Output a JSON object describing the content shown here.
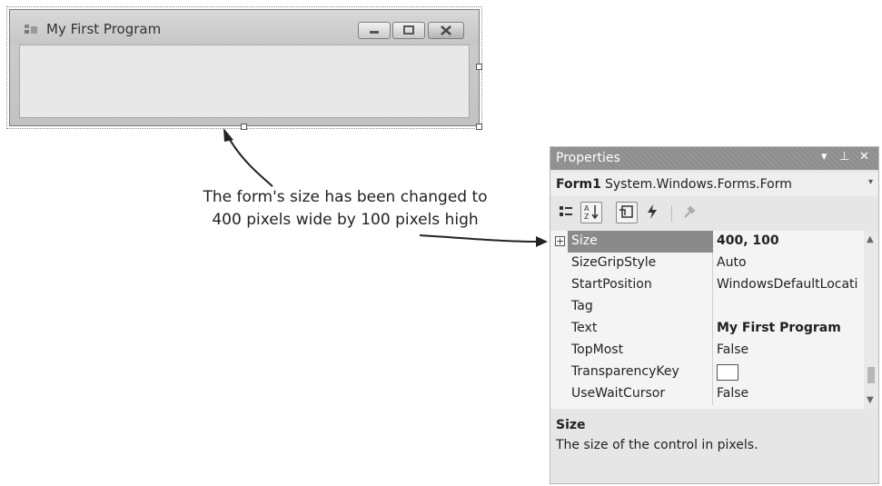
{
  "form": {
    "title": "My First Program",
    "controls": [
      "minimize",
      "maximize",
      "close"
    ]
  },
  "annotation": {
    "line1": "The form's size has been changed to",
    "line2": "400 pixels wide by 100 pixels high"
  },
  "properties": {
    "panel_title": "Properties",
    "title_icons": [
      "dropdown-icon",
      "pin-icon",
      "close-icon"
    ],
    "object_name": "Form1",
    "object_type": "System.Windows.Forms.Form",
    "toolbar_icons": [
      "categorized-icon",
      "alphabetical-icon",
      "properties-icon",
      "events-icon",
      "property-pages-icon"
    ],
    "rows": [
      {
        "name": "Size",
        "value": "400, 100",
        "selected": true,
        "bold": true,
        "expandable": true
      },
      {
        "name": "SizeGripStyle",
        "value": "Auto"
      },
      {
        "name": "StartPosition",
        "value": "WindowsDefaultLocati"
      },
      {
        "name": "Tag",
        "value": ""
      },
      {
        "name": "Text",
        "value": "My First Program",
        "bold": true
      },
      {
        "name": "TopMost",
        "value": "False"
      },
      {
        "name": "TransparencyKey",
        "value": "",
        "swatch": true
      },
      {
        "name": "UseWaitCursor",
        "value": "False"
      }
    ],
    "description": {
      "title": "Size",
      "text": "The size of the control in pixels."
    }
  }
}
